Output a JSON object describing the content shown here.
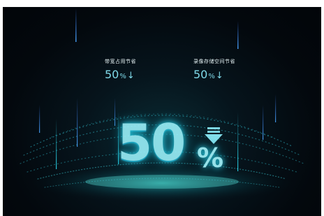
{
  "stats": [
    {
      "label": "带宽占用节省",
      "value": "50",
      "unit": "%",
      "arrow": "↓"
    },
    {
      "label": "录像存储空间节省",
      "value": "50",
      "unit": "%",
      "arrow": "↓"
    }
  ],
  "hero": {
    "value": "50",
    "unit": "%"
  },
  "icons": {
    "hero_arrow": "down-arrow-icon"
  },
  "colors": {
    "accent": "#7fd9e8",
    "glow": "#2ad8ee",
    "background": "#03080d"
  }
}
